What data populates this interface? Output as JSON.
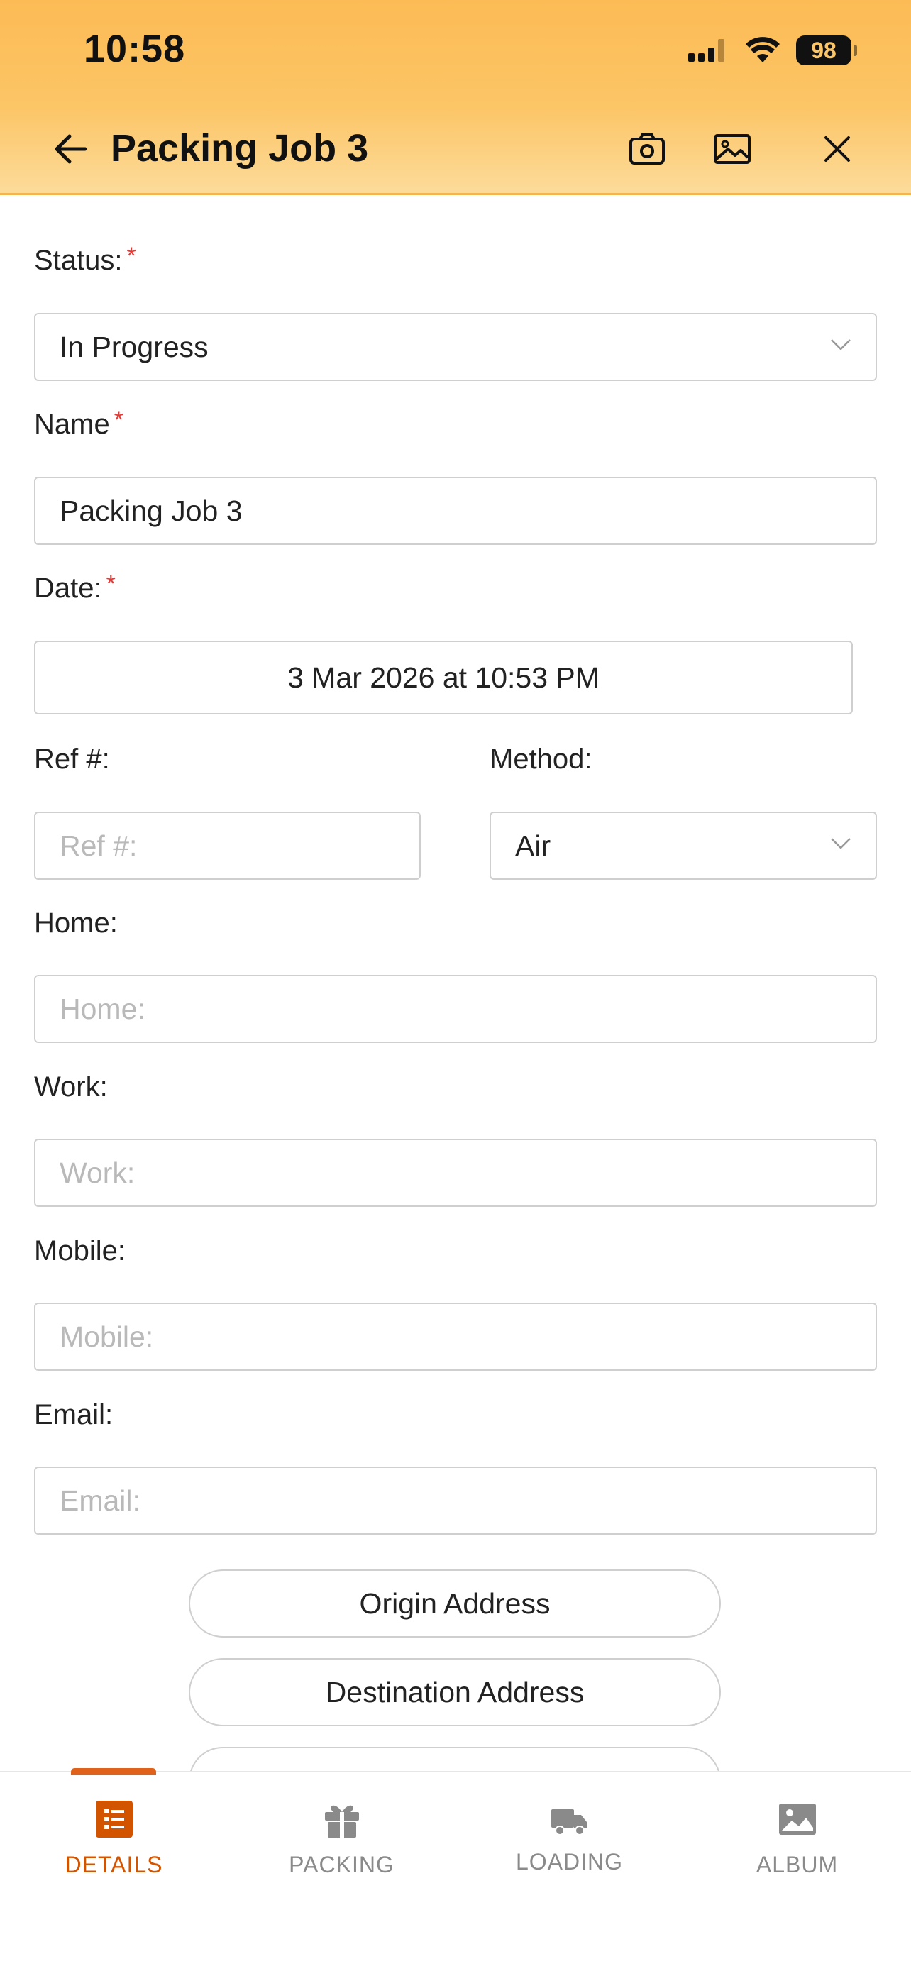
{
  "status_bar": {
    "time": "10:58",
    "battery": "98"
  },
  "header": {
    "title": "Packing Job 3"
  },
  "form": {
    "status_label": "Status:",
    "status_value": "In Progress",
    "name_label": "Name",
    "name_value": "Packing Job 3",
    "date_label": "Date:",
    "date_value": "3 Mar 2026 at 10:53 PM",
    "ref_label": "Ref #:",
    "ref_placeholder": "Ref #:",
    "method_label": "Method:",
    "method_value": "Air",
    "home_label": "Home:",
    "home_placeholder": "Home:",
    "work_label": "Work:",
    "work_placeholder": "Work:",
    "mobile_label": "Mobile:",
    "mobile_placeholder": "Mobile:",
    "email_label": "Email:",
    "email_placeholder": "Email:",
    "required_mark": "*"
  },
  "buttons": {
    "origin_address": "Origin Address",
    "destination_address": "Destination Address"
  },
  "bottom_nav": {
    "items": [
      {
        "label": "DETAILS",
        "icon": "list-icon",
        "active": true
      },
      {
        "label": "PACKING",
        "icon": "gift-icon",
        "active": false
      },
      {
        "label": "LOADING",
        "icon": "truck-icon",
        "active": false
      },
      {
        "label": "ALBUM",
        "icon": "image-icon",
        "active": false
      }
    ]
  },
  "colors": {
    "header": "#FCC566",
    "accent": "#E0621A",
    "required": "#E53935"
  }
}
